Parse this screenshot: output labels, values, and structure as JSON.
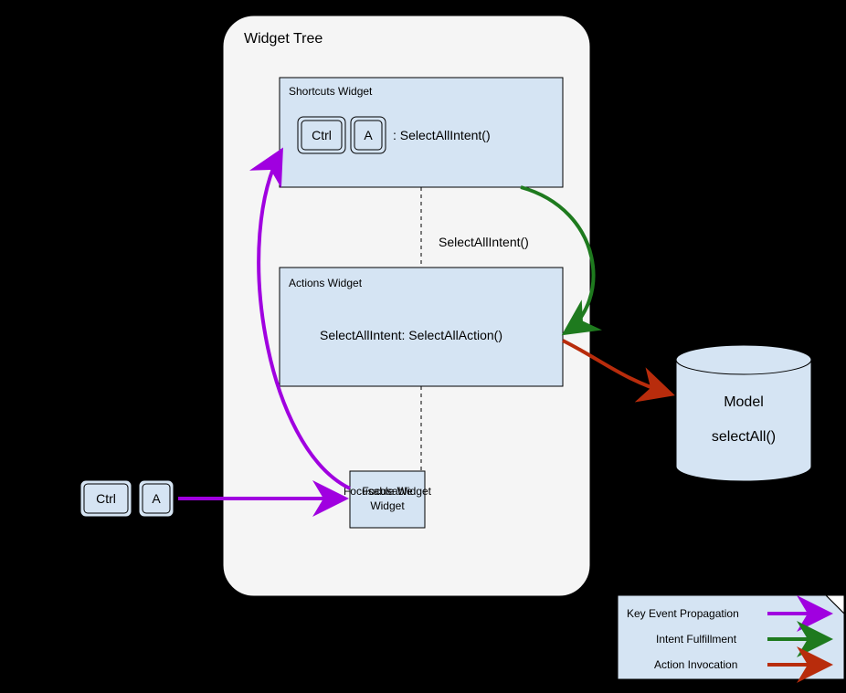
{
  "tree_title": "Widget Tree",
  "shortcuts": {
    "title": "Shortcuts Widget",
    "key1": "Ctrl",
    "key2": "A",
    "mapping": ": SelectAllIntent()"
  },
  "intent_label": "SelectAllIntent()",
  "actions": {
    "title": "Actions Widget",
    "mapping": "SelectAllIntent: SelectAllAction()"
  },
  "focusable": "Focusable Widget",
  "input_key1": "Ctrl",
  "input_key2": "A",
  "model": {
    "title": "Model",
    "method": "selectAll()"
  },
  "legend": {
    "key_event": "Key Event Propagation",
    "intent": "Intent Fulfillment",
    "action": "Action Invocation"
  },
  "colors": {
    "key_event": "#a000e0",
    "intent": "#1e7a1e",
    "action": "#b82c0c"
  }
}
